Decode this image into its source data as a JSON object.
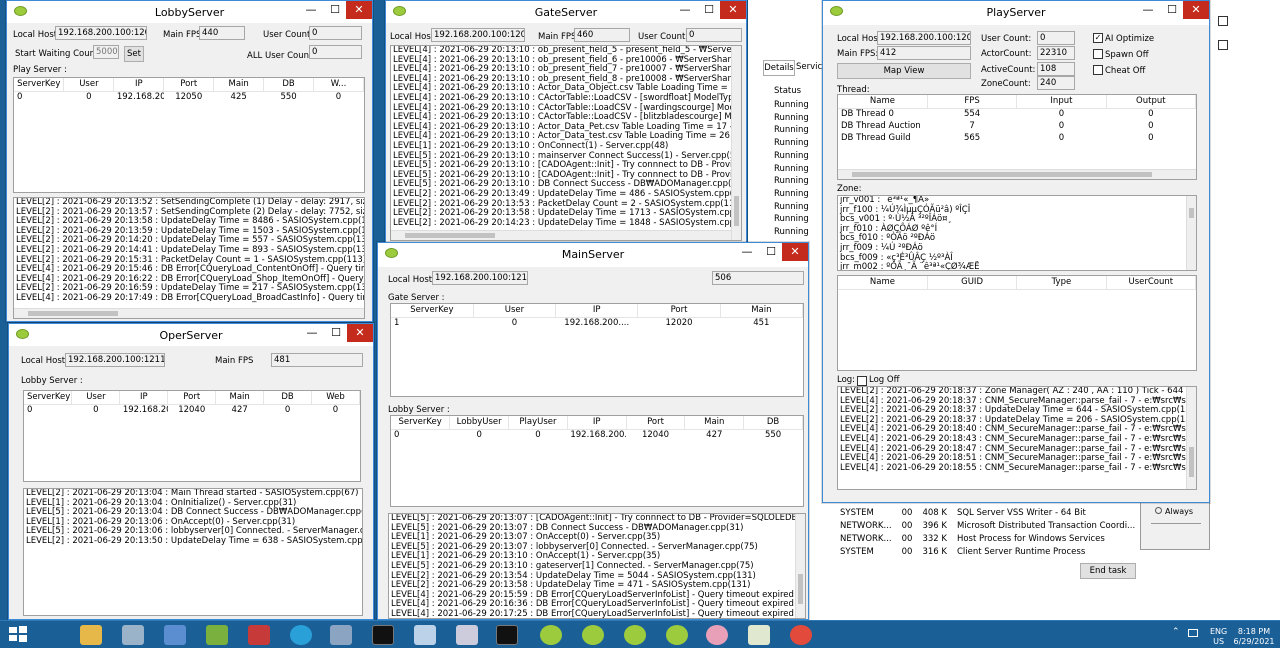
{
  "lobby": {
    "title": "LobbyServer",
    "local_host_label": "Local Host",
    "local_host": "192.168.200.100:12040",
    "main_fps_label": "Main FPS",
    "main_fps": "440",
    "user_count_label": "User Count",
    "user_count": "0",
    "start_waiting_label": "Start Waiting Count:",
    "start_waiting": "5000",
    "set_label": "Set",
    "all_user_label": "ALL User Count",
    "all_user": "0",
    "play_server_label": "Play Server :",
    "columns": [
      "ServerKey",
      "User",
      "IP",
      "Port",
      "Main",
      "DB",
      "W..."
    ],
    "rows": [
      [
        "0",
        "0",
        "192.168.200....",
        "12050",
        "425",
        "550",
        "0"
      ]
    ],
    "log": [
      "LEVEL[2] : 2021-06-29 20:13:52 : SetSendingComplete (1) Delay - delay: 2917, size: 13 -",
      "LEVEL[2] : 2021-06-29 20:13:57 : SetSendingComplete (2) Delay - delay: 7752, size: 13 -",
      "LEVEL[2] : 2021-06-29 20:13:58 : UpdateDelay Time = 8486 - SASIOSystem.cpp(131)",
      "LEVEL[2] : 2021-06-29 20:13:59 : UpdateDelay Time = 1503 - SASIOSystem.cpp(131)",
      "LEVEL[2] : 2021-06-29 20:14:20 : UpdateDelay Time = 557 - SASIOSystem.cpp(131)",
      "LEVEL[2] : 2021-06-29 20:14:41 : UpdateDelay Time = 893 - SASIOSystem.cpp(131)",
      "LEVEL[2] : 2021-06-29 20:15:31 : PacketDelay Count = 1 - SASIOSystem.cpp(113)",
      "LEVEL[4] : 2021-06-29 20:15:46 : DB Error[CQueryLoad_ContentOnOff] - Query timeout e",
      "LEVEL[4] : 2021-06-29 20:16:22 : DB Error[CQueryLoad_Shop_ItemOnOff] - Query timeou",
      "LEVEL[2] : 2021-06-29 20:16:59 : UpdateDelay Time = 217 - SASIOSystem.cpp(131)",
      "LEVEL[4] : 2021-06-29 20:17:49 : DB Error[CQueryLoad_BroadCastInfo] - Query timeout e"
    ]
  },
  "gate": {
    "title": "GateServer",
    "local_host_label": "Local Host",
    "local_host": "192.168.200.100:12020",
    "main_fps_label": "Main FPS",
    "main_fps": "460",
    "user_count_label": "User Count",
    "user_count": "0",
    "log": [
      "LEVEL[4] : 2021-06-29 20:13:10 : ob_present_field_5 - present_field_5 - ₩ServerShare₩",
      "LEVEL[4] : 2021-06-29 20:13:10 : ob_present_field_6 - pre10006 - ₩ServerShare₩Table",
      "LEVEL[4] : 2021-06-29 20:13:10 : ob_present_field_7 - pre10007 - ₩ServerShare₩Table",
      "LEVEL[4] : 2021-06-29 20:13:10 : ob_present_field_8 - pre10008 - ₩ServerShare₩Table",
      "LEVEL[4] : 2021-06-29 20:13:10 : Actor_Data_Object.csv Table Loading Time = 604 - x:₩",
      "LEVEL[4] : 2021-06-29 20:13:10 : CActorTable::LoadCSV - [swordfloat] ModelType Type",
      "LEVEL[4] : 2021-06-29 20:13:10 : CActorTable::LoadCSV - [wardingscourge] ModelType T",
      "LEVEL[4] : 2021-06-29 20:13:10 : CActorTable::LoadCSV - [blitzbladescourge] ModelType",
      "LEVEL[4] : 2021-06-29 20:13:10 : Actor_Data_Pet.csv Table Loading Time = 17 - x:₩src₩",
      "LEVEL[4] : 2021-06-29 20:13:10 : Actor_Data_test.csv Table Loading Time = 26 - x:₩src₩",
      "LEVEL[1] : 2021-06-29 20:13:10 : OnConnect(1) - Server.cpp(48)",
      "LEVEL[5] : 2021-06-29 20:13:10 : mainserver Connect Success(1) - Server.cpp(55)",
      "LEVEL[5] : 2021-06-29 20:13:10 : [CADOAgent::Init] - Try connnect to DB - Provider=SQL",
      "LEVEL[5] : 2021-06-29 20:13:10 : [CADOAgent::Init] - Try connnect to DB - Provider=SQL",
      "LEVEL[5] : 2021-06-29 20:13:10 : DB Connect Success - DB₩ADOManager.cpp(25)",
      "LEVEL[2] : 2021-06-29 20:13:49 : UpdateDelay Time = 486 - SASIOSystem.cpp(131)",
      "LEVEL[2] : 2021-06-29 20:13:53 : PacketDelay Count = 2 - SASIOSystem.cpp(113)",
      "LEVEL[2] : 2021-06-29 20:13:58 : UpdateDelay Time = 1713 - SASIOSystem.cpp(131)",
      "LEVEL[2] : 2021-06-29 20:14:23 : UpdateDelay Time = 1848 - SASIOSystem.cpp(131)"
    ]
  },
  "main": {
    "title": "MainServer",
    "local_host_label": "Local Host",
    "local_host": "192.168.200.100:12100",
    "fps": "506",
    "gate_server_label": "Gate Server :",
    "gate_columns": [
      "ServerKey",
      "User",
      "IP",
      "Port",
      "Main"
    ],
    "gate_rows": [
      [
        "1",
        "0",
        "192.168.200....",
        "12020",
        "451"
      ]
    ],
    "lobby_server_label": "Lobby Server :",
    "lobby_columns": [
      "ServerKey",
      "LobbyUser",
      "PlayUser",
      "IP",
      "Port",
      "Main",
      "DB"
    ],
    "lobby_rows": [
      [
        "0",
        "0",
        "0",
        "192.168.200....",
        "12040",
        "427",
        "550"
      ]
    ],
    "log": [
      "LEVEL[5] : 2021-06-29 20:13:07 : [CADOAgent::Init] - Try connnect to DB - Provider=SQLOLEDB.1;Data So",
      "LEVEL[5] : 2021-06-29 20:13:07 : DB Connect Success - DB₩ADOManager.cpp(31)",
      "LEVEL[1] : 2021-06-29 20:13:07 : OnAccept(0) - Server.cpp(35)",
      "LEVEL[5] : 2021-06-29 20:13:07 : lobbyserver[0] Connected. - ServerManager.cpp(75)",
      "LEVEL[1] : 2021-06-29 20:13:10 : OnAccept(1) - Server.cpp(35)",
      "LEVEL[5] : 2021-06-29 20:13:10 : gateserver[1] Connected. - ServerManager.cpp(75)",
      "LEVEL[2] : 2021-06-29 20:13:54 : UpdateDelay Time = 5044 - SASIOSystem.cpp(131)",
      "LEVEL[2] : 2021-06-29 20:13:58 : UpdateDelay Time = 471 - SASIOSystem.cpp(131)",
      "LEVEL[4] : 2021-06-29 20:15:59 : DB Error[CQueryLoadServerInfoList] - Query timeout expired - X:₩SRC₩S",
      "LEVEL[4] : 2021-06-29 20:16:36 : DB Error[CQueryLoadServerInfoList] - Query timeout expired - X:₩SRC₩S",
      "LEVEL[4] : 2021-06-29 20:17:25 : DB Error[CQueryLoadServerInfoList] - Query timeout expired - X:₩SRC₩S"
    ]
  },
  "oper": {
    "title": "OperServer",
    "local_host_label": "Local Host",
    "local_host": "192.168.200.100:12110",
    "main_fps_label": "Main FPS",
    "main_fps": "481",
    "lobby_server_label": "Lobby Server :",
    "columns": [
      "ServerKey",
      "User",
      "IP",
      "Port",
      "Main",
      "DB",
      "Web"
    ],
    "rows": [
      [
        "0",
        "0",
        "192.168.200....",
        "12040",
        "427",
        "0",
        "0"
      ]
    ],
    "log": [
      "LEVEL[2] : 2021-06-29 20:13:04 : Main Thread started - SASIOSystem.cpp(67)",
      "LEVEL[1] : 2021-06-29 20:13:04 : OnInitialize() - Server.cpp(31)",
      "LEVEL[5] : 2021-06-29 20:13:04 : DB Connect Success - DB₩ADOManager.cpp(48)",
      "LEVEL[1] : 2021-06-29 20:13:06 : OnAccept(0) - Server.cpp(31)",
      "LEVEL[5] : 2021-06-29 20:13:06 : lobbyserver[0] Connected. - ServerManager.cpp(16)",
      "LEVEL[2] : 2021-06-29 20:13:50 : UpdateDelay Time = 638 - SASIOSystem.cpp(131)"
    ]
  },
  "play": {
    "title": "PlayServer",
    "local_host_label": "Local Host:",
    "local_host": "192.168.200.100:12050",
    "main_fps_label": "Main FPS:",
    "main_fps": "412",
    "map_view_label": "Map View",
    "user_count_label": "User Count:",
    "user_count": "0",
    "actor_count_label": "ActorCount:",
    "actor_count": "22310",
    "active_count_label": "ActiveCount:",
    "active_count": "108",
    "zone_count_label": "ZoneCount:",
    "zone_count": "240",
    "ai_optimize_label": "AI Optimize",
    "spawn_off_label": "Spawn Off",
    "cheat_off_label": "Cheat Off",
    "thread_label": "Thread:",
    "thread_columns": [
      "Name",
      "FPS",
      "Input",
      "Output"
    ],
    "thread_rows": [
      [
        "DB Thread 0",
        "554",
        "0",
        "0"
      ],
      [
        "DB Thread Auction",
        "7",
        "0",
        "0"
      ],
      [
        "DB Thread Guild",
        "565",
        "0",
        "0"
      ]
    ],
    "zone_label": "Zone:",
    "zones": [
      "jrr_v001 : ¨ê³ª¹«_¶Ã»",
      "jrr_f100 : ¼Ú¾ÌµµÇÓÃü²â) ºÎÇÎ",
      "bcs_v001 : º·Ù½Â ³²ºÎÁö¤¸",
      "jrr_f010 : ÀØÇÔÁØ ºê°Í",
      "bcs_f010 : ºÒÃö ²ºÐÁö",
      "jrr_f009 : ¼Ú ²ºÐÁö",
      "bcs_f009 : «ç³É³ÛÂÇ ½º³ÀÎ",
      "jrr_m002 : ºÒÃ¸¯Ã ¨ê³ª¹«ÇØ¾ÆË"
    ],
    "obj_columns": [
      "Name",
      "GUID",
      "Type",
      "UserCount"
    ],
    "log_label": "Log:",
    "log_off_label": "Log Off",
    "log": [
      "LEVEL[2] : 2021-06-29 20:18:37 : Zone Manager( AZ : 240 , AA : 110 ) Tick - 644 - e:₩src₩",
      "LEVEL[4] : 2021-06-29 20:18:37 : CNM_SecureManager::parse_fail - 7 - e:₩src₩server₩pla",
      "LEVEL[2] : 2021-06-29 20:18:37 : UpdateDelay Time = 644 - SASIOSystem.cpp(131)",
      "LEVEL[2] : 2021-06-29 20:18:37 : UpdateDelay Time = 206 - SASIOSystem.cpp(131)",
      "LEVEL[4] : 2021-06-29 20:18:40 : CNM_SecureManager::parse_fail - 7 - e:₩src₩server₩pla",
      "LEVEL[4] : 2021-06-29 20:18:43 : CNM_SecureManager::parse_fail - 7 - e:₩src₩server₩pla",
      "LEVEL[4] : 2021-06-29 20:18:47 : CNM_SecureManager::parse_fail - 7 - e:₩src₩server₩pla",
      "LEVEL[4] : 2021-06-29 20:18:51 : CNM_SecureManager::parse_fail - 7 - e:₩src₩server₩pla",
      "LEVEL[4] : 2021-06-29 20:18:55 : CNM_SecureManager::parse_fail - 7 - e:₩src₩server₩pla"
    ]
  },
  "taskmgr": {
    "tab_details": "Details",
    "tab_services": "Service",
    "status_header": "Status",
    "status_rows": [
      "Running",
      "Running",
      "Running",
      "Running",
      "Running",
      "Running",
      "Running",
      "Running",
      "Running",
      "Running",
      "Running"
    ],
    "bottom_rows": [
      [
        "SYSTEM",
        "00",
        "408 K",
        "SQL Server VSS Writer - 64 Bit"
      ],
      [
        "NETWORK...",
        "00",
        "396 K",
        "Microsoft Distributed Transaction Coordi..."
      ],
      [
        "NETWORK...",
        "00",
        "332 K",
        "Host Process for Windows Services"
      ],
      [
        "SYSTEM",
        "00",
        "316 K",
        "Client Server Runtime Process"
      ]
    ],
    "end_task_label": "End task",
    "always_label": "Always"
  },
  "taskbar": {
    "lang": "ENG",
    "region": "US",
    "time": "8:18 PM",
    "date": "6/29/2021"
  }
}
